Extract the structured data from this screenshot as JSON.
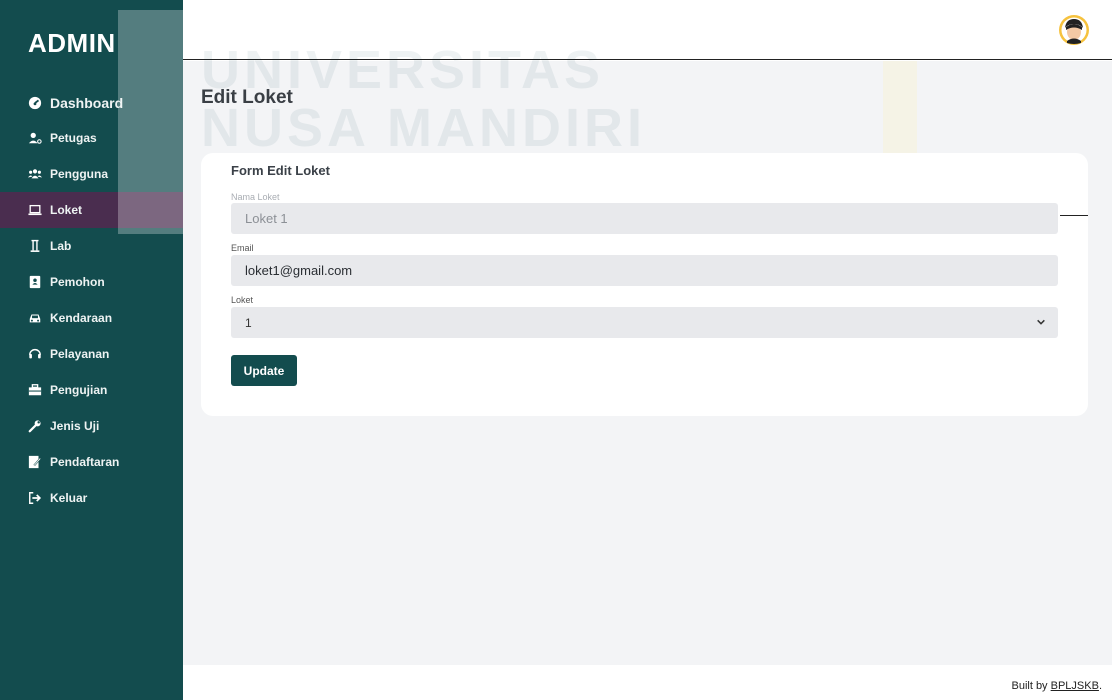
{
  "app": {
    "brand": "ADMIN",
    "watermark": [
      "UNIVERSITAS",
      "NUSA MANDIRI"
    ]
  },
  "sidebar": {
    "items": [
      {
        "label": "Dashboard",
        "icon": "gauge-icon",
        "active": false
      },
      {
        "label": "Petugas",
        "icon": "user-tie-icon",
        "active": false
      },
      {
        "label": "Pengguna",
        "icon": "users-icon",
        "active": false
      },
      {
        "label": "Loket",
        "icon": "laptop-icon",
        "active": true
      },
      {
        "label": "Lab",
        "icon": "flask-icon",
        "active": false
      },
      {
        "label": "Pemohon",
        "icon": "address-book-icon",
        "active": false
      },
      {
        "label": "Kendaraan",
        "icon": "car-icon",
        "active": false
      },
      {
        "label": "Pelayanan",
        "icon": "headset-icon",
        "active": false
      },
      {
        "label": "Pengujian",
        "icon": "toolbox-icon",
        "active": false
      },
      {
        "label": "Jenis Uji",
        "icon": "wrench-icon",
        "active": false
      },
      {
        "label": "Pendaftaran",
        "icon": "signature-icon",
        "active": false
      },
      {
        "label": "Keluar",
        "icon": "sign-out-icon",
        "active": false
      }
    ]
  },
  "header": {
    "avatar": "user-avatar-icon"
  },
  "main": {
    "title": "Edit Loket",
    "form": {
      "title": "Form Edit Loket",
      "fields": {
        "nama_loket": {
          "label": "Nama Loket",
          "value": "Loket 1"
        },
        "email": {
          "label": "Email",
          "value": "loket1@gmail.com"
        },
        "loket": {
          "label": "Loket",
          "value": "1"
        }
      },
      "submit_label": "Update"
    }
  },
  "footer": {
    "prefix": "Built by ",
    "link": "BPLJSKB",
    "suffix": "."
  },
  "colors": {
    "sidebar": "#134c4e",
    "active_item": "#4a2d4f",
    "content_bg": "#f3f4f6",
    "field_bg": "#e8e9ec",
    "button": "#134c4e"
  }
}
